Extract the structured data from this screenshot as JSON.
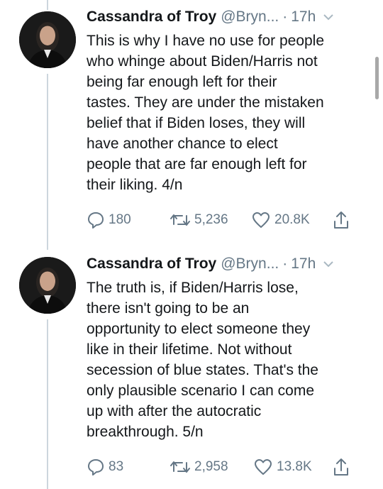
{
  "tweets": [
    {
      "name": "Cassandra of Troy",
      "handle": "@Bryn...",
      "separator": "·",
      "time": "17h",
      "lines": [
        "This is why I have no use for people",
        "who whinge about Biden/Harris not",
        "being far enough left for their",
        "tastes. They are under the mistaken",
        "belief that if Biden loses, they will",
        "have another chance to elect",
        "people that are far enough left for",
        "their liking. 4/n"
      ],
      "replies": "180",
      "retweets": "5,236",
      "likes": "20.8K"
    },
    {
      "name": "Cassandra of Troy",
      "handle": "@Bryn...",
      "separator": "·",
      "time": "17h",
      "lines": [
        "The truth is, if Biden/Harris lose,",
        "there isn't going to be an",
        "opportunity to elect someone they",
        "like in their lifetime. Not without",
        "secession of blue states. That's the",
        "only plausible scenario I can come",
        "up with after the autocratic",
        "breakthrough. 5/n"
      ],
      "replies": "83",
      "retweets": "2,958",
      "likes": "13.8K"
    }
  ],
  "icons": {
    "reply": "reply-icon",
    "retweet": "retweet-icon",
    "like": "heart-icon",
    "share": "share-icon",
    "menu": "chevron-down-icon"
  },
  "colors": {
    "text": "#14171a",
    "secondary": "#657786",
    "thread_line": "#ccd6dd",
    "background": "#ffffff"
  }
}
